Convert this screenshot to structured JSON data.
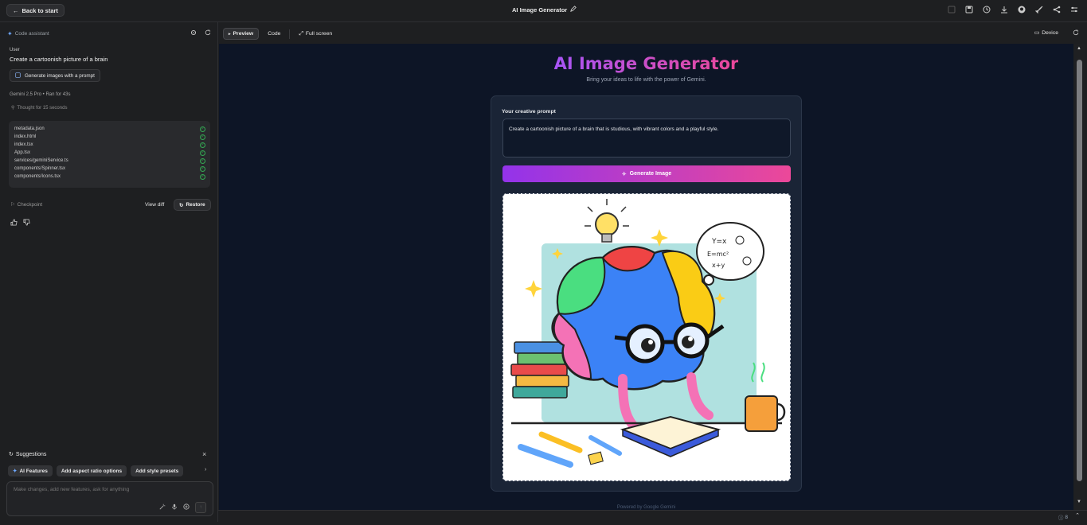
{
  "topbar": {
    "back_label": "Back to start",
    "app_title": "AI Image Generator"
  },
  "left_panel": {
    "header": "Code assistant",
    "user_label": "User",
    "user_message": "Create a cartoonish picture of a brain",
    "prompt_chip": "Generate images with a prompt",
    "model_info": "Gemini 2.5 Pro  •  Ran for 43s",
    "thought": "Thought for 15 seconds",
    "files": [
      "metadata.json",
      "index.html",
      "index.tsx",
      "App.tsx",
      "services/geminiService.ts",
      "components/Spinner.tsx",
      "components/Icons.tsx"
    ],
    "checkpoint_label": "Checkpoint",
    "view_diff_label": "View diff",
    "restore_label": "Restore",
    "suggestions_title": "Suggestions",
    "suggestions": [
      "AI Features",
      "Add aspect ratio options",
      "Add style presets"
    ],
    "input_placeholder": "Make changes, add new features, ask for anything"
  },
  "right_panel": {
    "tabs": [
      "Preview",
      "Code",
      "Full screen"
    ],
    "device_label": "Device",
    "status_count": "8"
  },
  "preview": {
    "title": "AI Image Generator",
    "subtitle": "Bring your ideas to life with the power of Gemini.",
    "prompt_label": "Your creative prompt",
    "prompt_value": "Create a cartoonish picture of a brain that is studious, with vibrant colors and a playful style.",
    "generate_label": "Generate Image",
    "footer": "Powered by Google Gemini",
    "image_note": {
      "thought_bubble": "Y=x E=mc² x+y"
    }
  },
  "colors": {
    "accent_purple": "#9333ea",
    "accent_pink": "#ec4899",
    "success_green": "#34a853",
    "preview_bg": "#0d1526"
  }
}
